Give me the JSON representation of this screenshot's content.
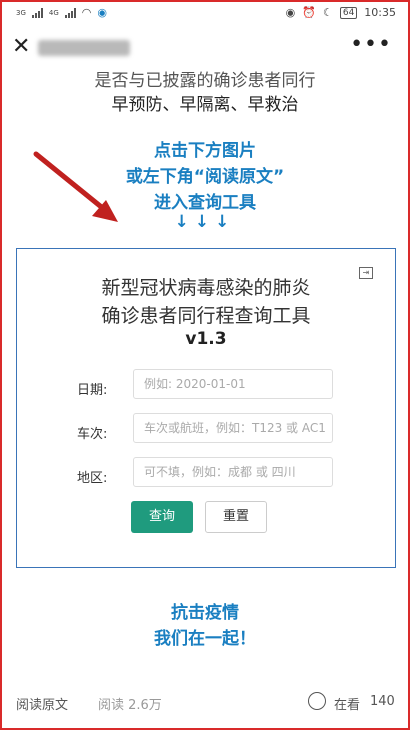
{
  "status_bar": {
    "signal1": "3G",
    "signal2": "4G",
    "battery": "64",
    "time": "10:35"
  },
  "nav": {
    "close_icon": "close-icon",
    "more_label": "•••"
  },
  "article": {
    "line1": "是否与已披露的确诊患者同行",
    "line2": "早预防、早隔离、早救治",
    "instruction1": "点击下方图片",
    "instruction2": "或左下角“阅读原文”",
    "instruction3": "进入查询工具",
    "arrows": "↓↓↓"
  },
  "tool": {
    "title1": "新型冠状病毒感染的肺炎",
    "title2": "确诊患者同行程查询工具",
    "version": "v1.3",
    "date_label": "日期:",
    "date_placeholder": "例如: 2020-01-01",
    "train_label": "车次:",
    "train_placeholder": "车次或航班，例如：T123 或 AC1",
    "region_label": "地区:",
    "region_placeholder": "可不填，例如：成都 或 四川",
    "query_button": "查询",
    "reset_button": "重置"
  },
  "closing": {
    "line1": "抗击疫情",
    "line2": "我们在一起！"
  },
  "bottom_bar": {
    "read_original": "阅读原文",
    "read_count": "阅读 2.6万",
    "wow_label": "在看",
    "wow_count": "140"
  },
  "colors": {
    "accent_blue": "#1a7fc1",
    "query_green": "#1f9b7e",
    "frame_red": "#d92a2a"
  }
}
